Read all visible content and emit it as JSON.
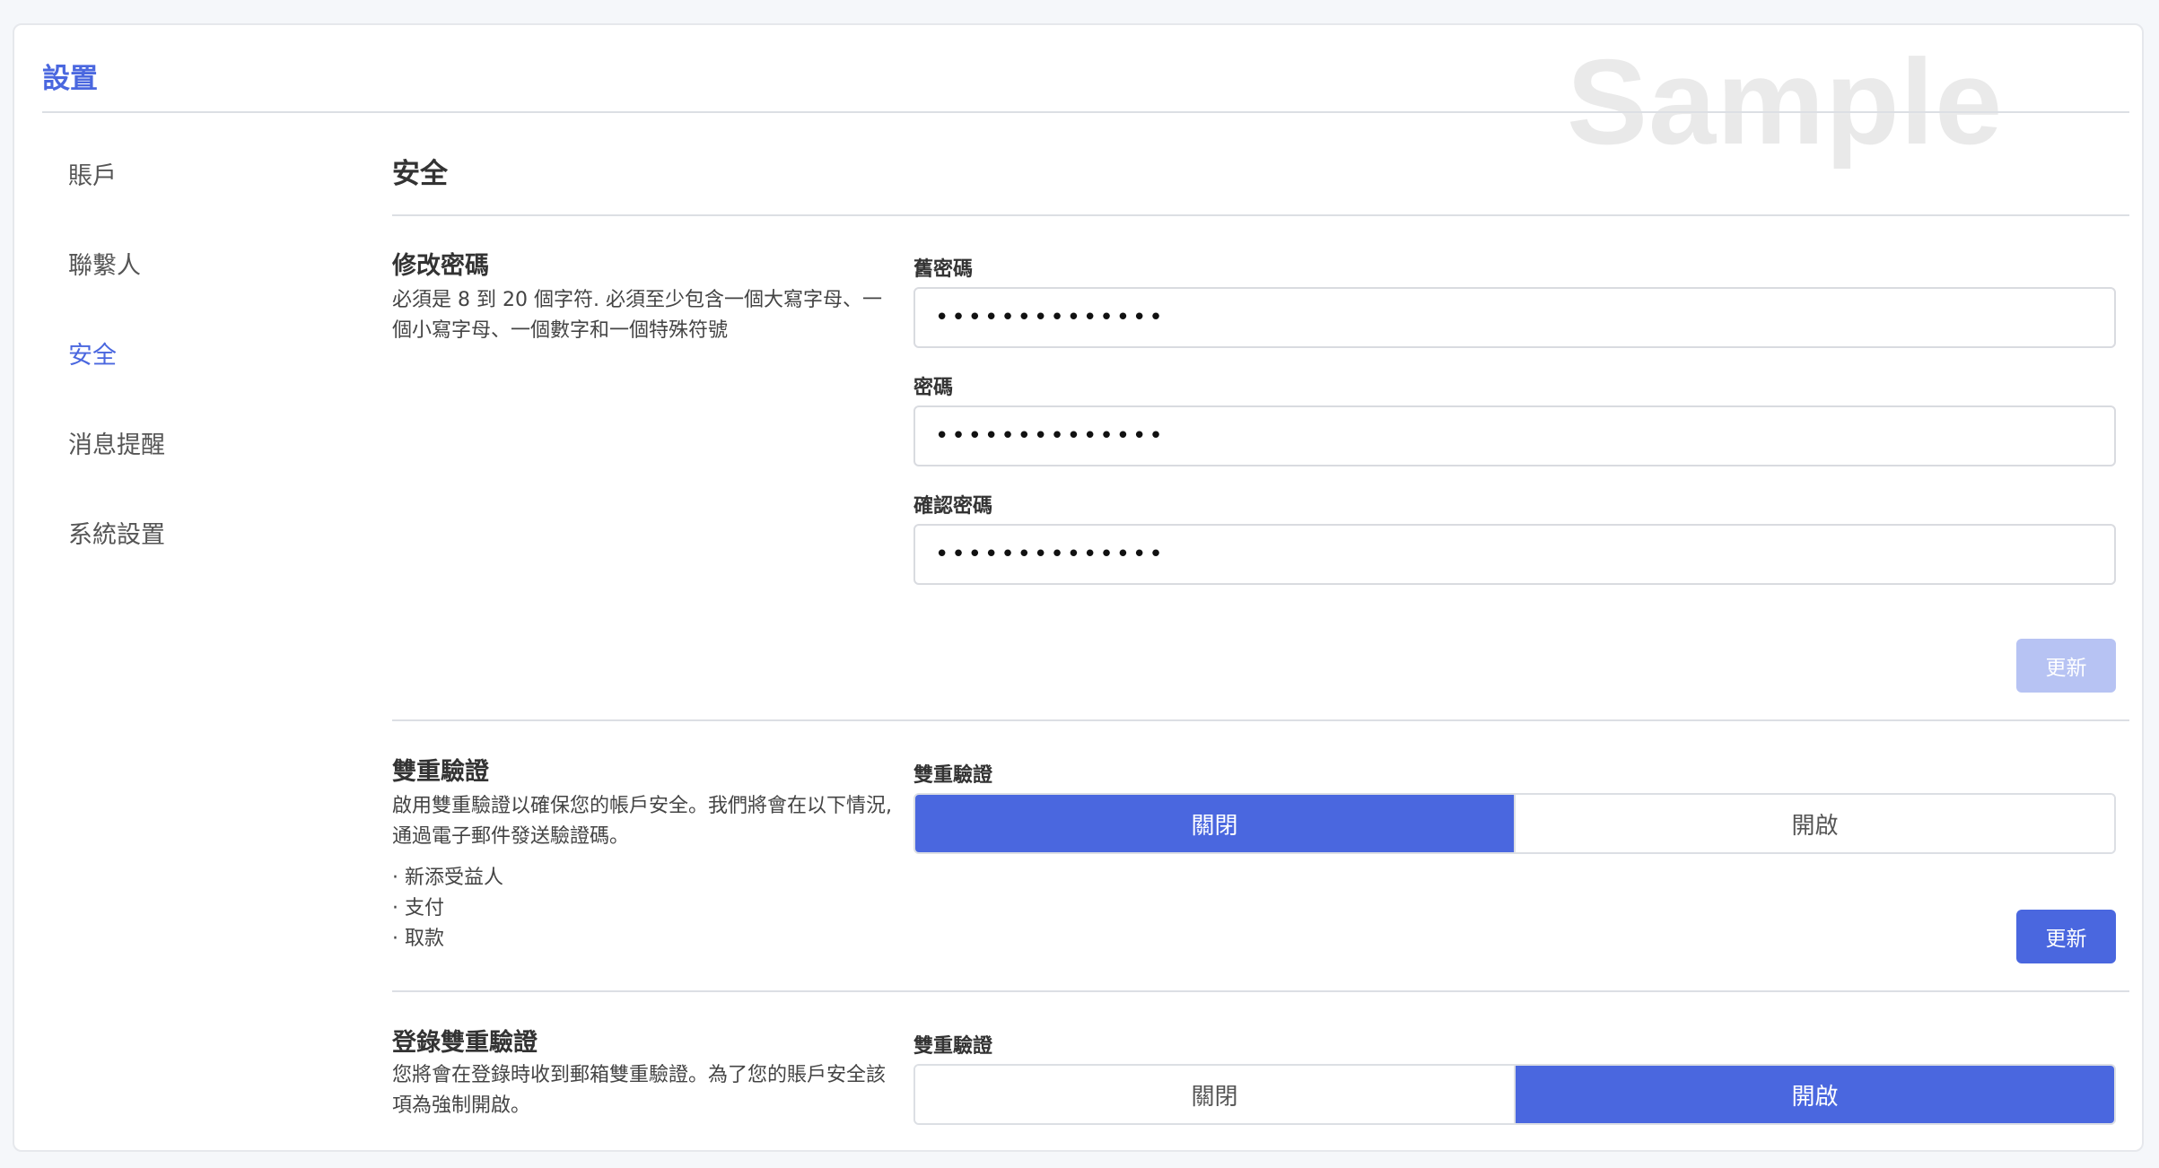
{
  "page": {
    "title": "設置",
    "watermark": "Sample"
  },
  "nav": {
    "items": [
      {
        "label": "賬戶"
      },
      {
        "label": "聯繫人"
      },
      {
        "label": "安全"
      },
      {
        "label": "消息提醒"
      },
      {
        "label": "系統設置"
      }
    ],
    "active": "安全"
  },
  "section": {
    "title": "安全"
  },
  "password": {
    "title": "修改密碼",
    "desc": "必須是 8 到 20 個字符. 必須至少包含一個大寫字母、一個小寫字母、一個數字和一個特殊符號",
    "old_label": "舊密碼",
    "old_value": "••••••••••••••",
    "new_label": "密碼",
    "new_value": "••••••••••••••",
    "confirm_label": "確認密碼",
    "confirm_value": "••••••••••••••",
    "submit_label": "更新"
  },
  "two_factor": {
    "title": "雙重驗證",
    "desc": " 啟用雙重驗證以確保您的帳戶安全。我們將會在以下情況,通過電子郵件發送驗證碼。",
    "bullets": [
      "· 新添受益人",
      "· 支付",
      "· 取款"
    ],
    "field_label": "雙重驗證",
    "off_label": "關閉",
    "on_label": "開啟",
    "selected": "關閉",
    "submit_label": "更新"
  },
  "login_two_factor": {
    "title": "登錄雙重驗證",
    "desc": "您將會在登錄時收到郵箱雙重驗證。為了您的賬戶安全該項為強制開啟。",
    "field_label": "雙重驗證",
    "off_label": "關閉",
    "on_label": "開啟",
    "selected": "開啟"
  },
  "colors": {
    "accent": "#4a67df",
    "accent_disabled": "#b7c3f3"
  }
}
